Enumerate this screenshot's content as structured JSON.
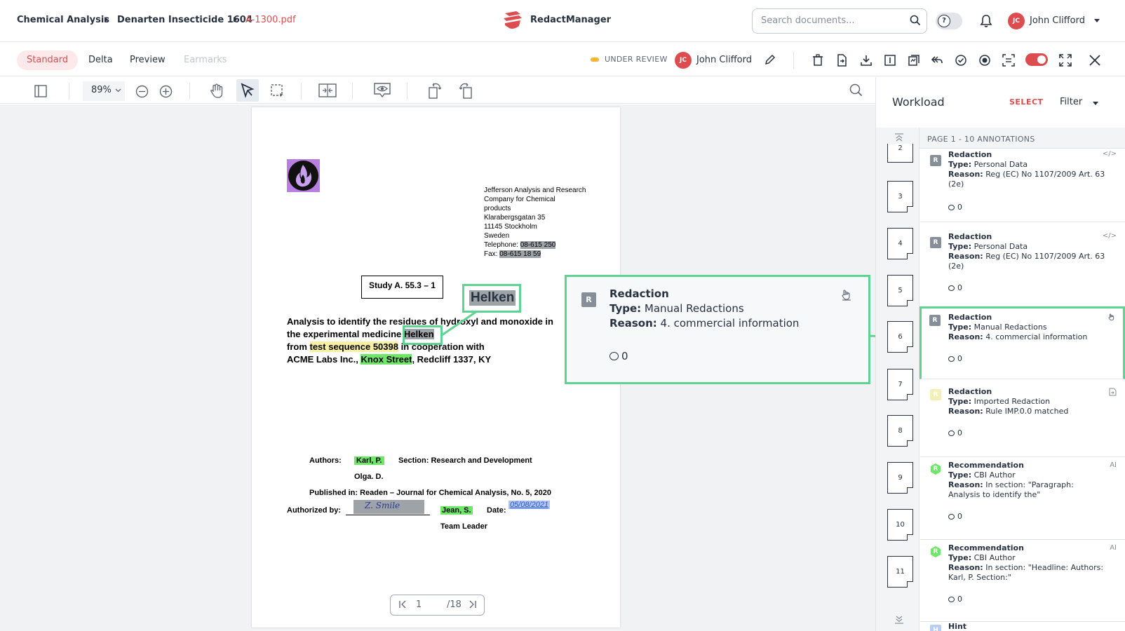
{
  "breadcrumb": {
    "items": [
      "Chemical Analysis",
      "Denarten Insecticide 1604"
    ],
    "file": "A-1300.pdf"
  },
  "app": {
    "name": "RedactManager"
  },
  "search": {
    "placeholder": "Search documents..."
  },
  "user": {
    "initials": "JC",
    "name": "John Clifford"
  },
  "modes": {
    "tabs": [
      "Standard",
      "Delta",
      "Preview",
      "Earmarks"
    ],
    "active": "Standard"
  },
  "status": {
    "label": "UNDER REVIEW",
    "assignee_initials": "JC",
    "assignee": "John Clifford"
  },
  "viewer": {
    "zoom": "89%",
    "page_current": "1",
    "page_total": "/18"
  },
  "document": {
    "address": [
      "Jefferson Analysis and Research",
      "Company for Chemical",
      "products",
      "Klarabergsgatan 35",
      "11145 Stockholm",
      "Sweden"
    ],
    "telephone_label": "Telephone: ",
    "telephone": "08-615 250",
    "fax_label": "Fax: ",
    "fax": "08-615 18 59",
    "study": "Study A. 55.3 – 1",
    "para_l1": "Analysis to identify the residues of hydroxyl and monoxide in",
    "para_l2a": "the experimental medicine ",
    "para_l2_redacted": "Helken",
    "para_l3a": "from ",
    "para_l3_hl": "test sequence 50398",
    "para_l3b": " in cooperation with",
    "para_l4a": "ACME Labs Inc., ",
    "para_l4_hl": "Knox Street",
    "para_l4b": ", Redcliff 1337, KY",
    "authors_label": "Authors:",
    "author1": "Karl, P.",
    "section": "Section: Research and Development",
    "author2": "Olga. D.",
    "published": "Published in: Readen – Journal for Chemical Analysis, No. 5, 2020",
    "authorized_label": "Authorized by:",
    "signature": "Z. Smile",
    "authorized_name": "Jean, S.",
    "date_label": "Date:",
    "date": "05/08/2021",
    "role": "Team Leader"
  },
  "zoom_callout": {
    "word": "Helken",
    "card_icon": "R",
    "card_title": "Redaction",
    "card_type_label": "Type:",
    "card_type": " Manual Redactions",
    "card_reason_label": "Reason:",
    "card_reason": " 4. commercial information",
    "card_comments": "0"
  },
  "workload": {
    "title": "Workload",
    "select": "SELECT",
    "filter": "Filter",
    "header": "PAGE 1 - 10 ANNOTATIONS",
    "thumbs": [
      "2",
      "3",
      "4",
      "5",
      "6",
      "7",
      "8",
      "9",
      "10",
      "11"
    ],
    "annotations": [
      {
        "icon": "R",
        "title": "Redaction",
        "type_label": "Type:",
        "type": " Personal Data",
        "reason_label": "Reason:",
        "reason": " Reg (EC) No 1107/2009 Art. 63 (2e)",
        "comments": "0",
        "color": "#868e99",
        "tag": "code-icon"
      },
      {
        "icon": "R",
        "title": "Redaction",
        "type_label": "Type:",
        "type": " Personal Data",
        "reason_label": "Reason:",
        "reason": " Reg (EC) No 1107/2009 Art. 63 (2e)",
        "comments": "0",
        "color": "#868e99",
        "tag": "code-icon"
      },
      {
        "icon": "R",
        "title": "Redaction",
        "type_label": "Type:",
        "type": " Manual Redactions",
        "reason_label": "Reason:",
        "reason": " 4. commercial information",
        "comments": "0",
        "color": "#868e99",
        "tag": "hand-icon"
      },
      {
        "icon": "R",
        "title": "Redaction",
        "type_label": "Type:",
        "type": " Imported Redaction",
        "reason_label": "Reason:",
        "reason": " Rule IMP.0.0 matched",
        "comments": "0",
        "color": "#f3f0b5",
        "tag": "import-icon"
      },
      {
        "icon": "R",
        "title": "Recommendation",
        "type_label": "Type:",
        "type": " CBI Author",
        "reason_label": "Reason:",
        "reason": " In section: \"Paragraph: Analysis to identify the\"",
        "comments": "0",
        "color": "#6ee667",
        "tag": "AI"
      },
      {
        "icon": "R",
        "title": "Recommendation",
        "type_label": "Type:",
        "type": " CBI Author",
        "reason_label": "Reason:",
        "reason": " In section: \"Headline: Authors: Karl, P. Section:\"",
        "comments": "0",
        "color": "#6ee667",
        "tag": "AI"
      },
      {
        "icon": "H",
        "title": "Hint",
        "color": "#b8cdf5"
      }
    ]
  },
  "colors": {
    "accent": "#dd4d50",
    "highlight_green": "#5fd391",
    "status_yellow": "#f6b535"
  }
}
